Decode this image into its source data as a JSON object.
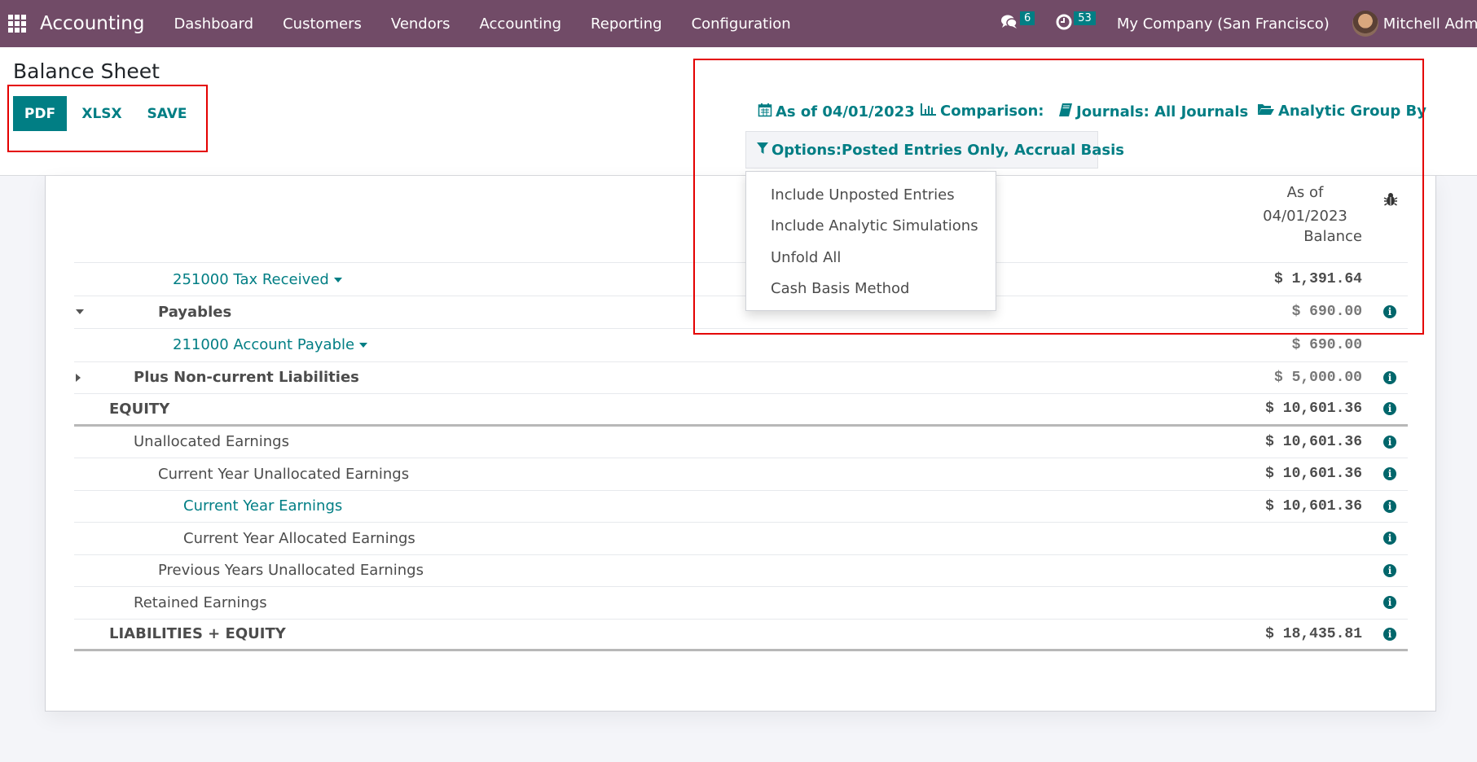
{
  "navbar": {
    "app_name": "Accounting",
    "menu": [
      "Dashboard",
      "Customers",
      "Vendors",
      "Accounting",
      "Reporting",
      "Configuration"
    ],
    "messages_count": "6",
    "activities_count": "53",
    "company": "My Company (San Francisco)",
    "user": "Mitchell Admi"
  },
  "control_panel": {
    "title": "Balance Sheet",
    "buttons": {
      "pdf": "PDF",
      "xlsx": "XLSX",
      "save": "SAVE"
    },
    "filters": {
      "date": "As of 04/01/2023",
      "comparison": "Comparison:",
      "journals": "Journals: All Journals",
      "analytic": "Analytic Group By",
      "options": "Options:Posted Entries Only, Accrual Basis"
    }
  },
  "options_dropdown": {
    "items": [
      "Include Unposted Entries",
      "Include Analytic Simulations",
      "Unfold All",
      "Cash Basis Method"
    ]
  },
  "table": {
    "header": {
      "date_line1": "As of",
      "date_line2": "04/01/2023",
      "balance": "Balance"
    },
    "rows": [
      {
        "label": "251000 Tax Received",
        "amount": "$ 1,391.64",
        "level": 4,
        "style": "account",
        "info": false
      },
      {
        "label": "Payables",
        "amount": "$ 690.00",
        "level": 3,
        "style": "bold",
        "fold": "down",
        "info": true
      },
      {
        "label": "211000 Account Payable",
        "amount": "$ 690.00",
        "level": 4,
        "style": "account",
        "info": false
      },
      {
        "label": "Plus Non-current Liabilities",
        "amount": "$ 5,000.00",
        "level": 2,
        "style": "bold",
        "fold": "right",
        "info": true
      },
      {
        "label": "EQUITY",
        "amount": "$ 10,601.36",
        "level": 1,
        "style": "bold",
        "info": true
      },
      {
        "label": "Unallocated Earnings",
        "amount": "$ 10,601.36",
        "level": 2,
        "style": "normal",
        "info": true
      },
      {
        "label": "Current Year Unallocated Earnings",
        "amount": "$ 10,601.36",
        "level": 3,
        "style": "normal",
        "info": true
      },
      {
        "label": "Current Year Earnings",
        "amount": "$ 10,601.36",
        "level": 4,
        "style": "link",
        "info": true
      },
      {
        "label": "Current Year Allocated Earnings",
        "amount": "",
        "level": 4,
        "style": "normal",
        "info": true
      },
      {
        "label": "Previous Years Unallocated Earnings",
        "amount": "",
        "level": 3,
        "style": "normal",
        "info": true
      },
      {
        "label": "Retained Earnings",
        "amount": "",
        "level": 2,
        "style": "normal",
        "info": true
      },
      {
        "label": "LIABILITIES + EQUITY",
        "amount": "$ 18,435.81",
        "level": 1,
        "style": "bold",
        "info": true
      }
    ]
  },
  "colors": {
    "navbar": "#714b67",
    "primary": "#017e84",
    "annotation": "#e40000"
  }
}
